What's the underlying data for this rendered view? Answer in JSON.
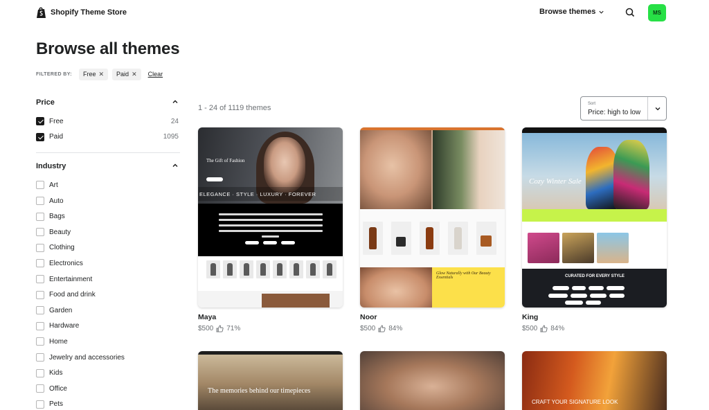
{
  "header": {
    "brand": "Shopify Theme Store",
    "browse_label": "Browse themes",
    "avatar_initials": "MS",
    "avatar_color": "#27e046"
  },
  "page": {
    "title": "Browse all themes",
    "filtered_by_label": "FILTERED BY:",
    "chips": [
      "Free",
      "Paid"
    ],
    "clear_label": "Clear"
  },
  "sidebar": {
    "price": {
      "title": "Price",
      "options": [
        {
          "label": "Free",
          "count": "24",
          "checked": true
        },
        {
          "label": "Paid",
          "count": "1095",
          "checked": true
        }
      ]
    },
    "industry": {
      "title": "Industry",
      "options": [
        "Art",
        "Auto",
        "Bags",
        "Beauty",
        "Clothing",
        "Electronics",
        "Entertainment",
        "Food and drink",
        "Garden",
        "Hardware",
        "Home",
        "Jewelry and accessories",
        "Kids",
        "Office",
        "Pets"
      ]
    }
  },
  "results": {
    "count_text": "1 - 24 of 1119 themes",
    "sort_label": "Sort",
    "sort_value": "Price: high to low"
  },
  "themes": [
    {
      "name": "Maya",
      "price": "$500",
      "rating": "71%",
      "thumb": {
        "heading": "The Gift of Fashion",
        "ticker": "ELEGANCE  ·  STYLE  ·  LUXURY  ·  FOREVER"
      }
    },
    {
      "name": "Noor",
      "price": "$500",
      "rating": "84%",
      "thumb": {
        "banner": "Glow Naturally with Our Beauty Essentials"
      }
    },
    {
      "name": "King",
      "price": "$500",
      "rating": "84%",
      "thumb": {
        "heading": "Cozy Winter Sale",
        "section": "CURATED FOR EVERY STYLE"
      }
    }
  ],
  "row2": [
    {
      "thumb_text": "The memories behind our timepieces"
    },
    {
      "thumb_text": ""
    },
    {
      "thumb_text": "CRAFT YOUR SIGNATURE LOOK"
    }
  ]
}
